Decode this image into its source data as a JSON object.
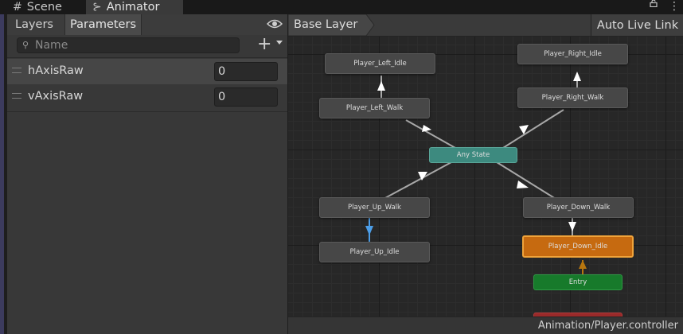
{
  "window": {
    "tabs": [
      {
        "label": "Scene",
        "icon": "scene-grid-icon"
      },
      {
        "label": "Animator",
        "icon": "animator-icon",
        "active": true
      }
    ]
  },
  "left_panel": {
    "tabs": [
      {
        "label": "Layers"
      },
      {
        "label": "Parameters",
        "active": true
      }
    ],
    "search_placeholder": "Name",
    "add_label": "+",
    "parameters": [
      {
        "name": "hAxisRaw",
        "value": "0"
      },
      {
        "name": "vAxisRaw",
        "value": "0"
      }
    ]
  },
  "graph": {
    "breadcrumb": "Base Layer",
    "auto_live_link": "Auto Live Link",
    "states": {
      "left_idle": "Player_Left_Idle",
      "left_walk": "Player_Left_Walk",
      "right_idle": "Player_Right_Idle",
      "right_walk": "Player_Right_Walk",
      "any_state": "Any State",
      "up_walk": "Player_Up_Walk",
      "up_idle": "Player_Up_Idle",
      "down_walk": "Player_Down_Walk",
      "down_idle": "Player_Down_Idle",
      "entry": "Entry",
      "exit": ""
    },
    "colors": {
      "state_default": "#474747",
      "any_state": "#3d8a7f",
      "default_state": "#c66a10",
      "entry": "#177a2b",
      "exit": "#9a2a2a",
      "transition": "#a8a8a8",
      "highlighted_transition": "#4c9ee8",
      "entry_transition": "#b8770f"
    },
    "asset_path": "Animation/Player.controller"
  }
}
